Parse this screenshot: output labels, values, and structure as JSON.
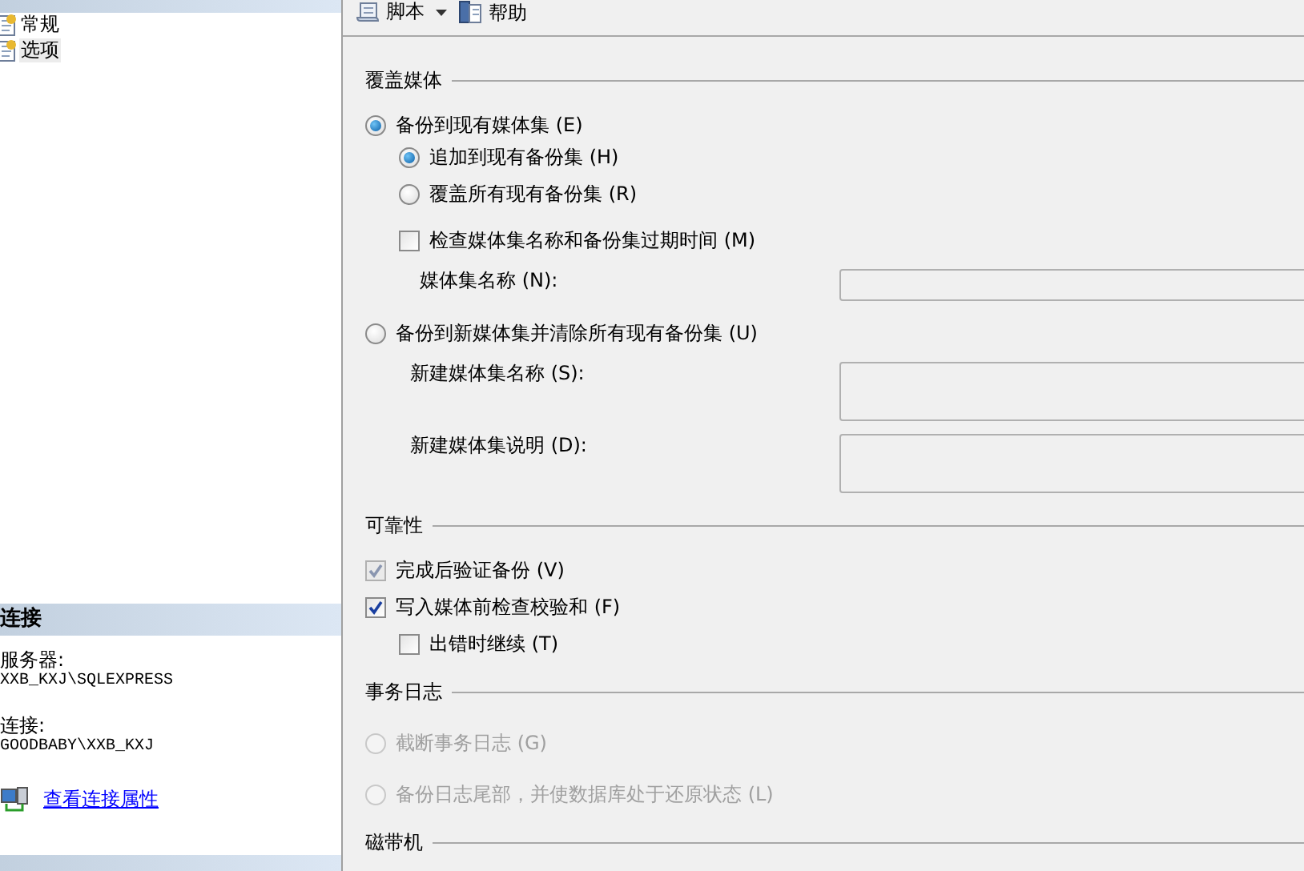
{
  "sidebar": {
    "pages": [
      {
        "label": "常规",
        "selected": false
      },
      {
        "label": "选项",
        "selected": true
      }
    ]
  },
  "connection": {
    "title": "连接",
    "fields": [
      {
        "label": "服务器:",
        "value": "XXB_KXJ\\SQLEXPRESS"
      },
      {
        "label": "连接:",
        "value": "GOODBABY\\XXB_KXJ"
      }
    ],
    "link": "查看连接属性"
  },
  "toolbar": [
    {
      "kind": "script",
      "label": "脚本"
    },
    {
      "kind": "help",
      "label": "帮助"
    }
  ],
  "sections": [
    {
      "title": "覆盖媒体",
      "items": [
        {
          "kind": "radio",
          "label": "备份到现有媒体集 (E)",
          "selected": true,
          "disabled": false,
          "children": [
            {
              "kind": "radio",
              "label": "追加到现有备份集 (H)",
              "selected": true,
              "disabled": false
            },
            {
              "kind": "radio",
              "label": "覆盖所有现有备份集 (R)",
              "selected": false,
              "disabled": false
            },
            {
              "kind": "checkbox",
              "label": "检查媒体集名称和备份集过期时间 (M)",
              "checked": false,
              "disabled": false,
              "children": [
                {
                  "kind": "field",
                  "label": "媒体集名称 (N):",
                  "multiline": false
                }
              ]
            }
          ]
        },
        {
          "kind": "radio",
          "label": "备份到新媒体集并清除所有现有备份集 (U)",
          "selected": false,
          "disabled": false,
          "children": [
            {
              "kind": "field",
              "label": "新建媒体集名称 (S):",
              "multiline": true
            },
            {
              "kind": "field",
              "label": "新建媒体集说明 (D):",
              "multiline": true
            }
          ]
        }
      ]
    },
    {
      "title": "可靠性",
      "items": [
        {
          "kind": "checkbox",
          "label": "完成后验证备份 (V)",
          "checked": true,
          "disabled": true
        },
        {
          "kind": "checkbox",
          "label": "写入媒体前检查校验和 (F)",
          "checked": true,
          "disabled": false,
          "children": [
            {
              "kind": "checkbox",
              "label": "出错时继续 (T)",
              "checked": false,
              "disabled": false
            }
          ]
        }
      ]
    },
    {
      "title": "事务日志",
      "items": [
        {
          "kind": "radio",
          "label": "截断事务日志 (G)",
          "selected": false,
          "disabled": true
        },
        {
          "kind": "radio",
          "label": "备份日志尾部，并使数据库处于还原状态 (L)",
          "selected": false,
          "disabled": true
        }
      ]
    },
    {
      "title": "磁带机"
    }
  ]
}
